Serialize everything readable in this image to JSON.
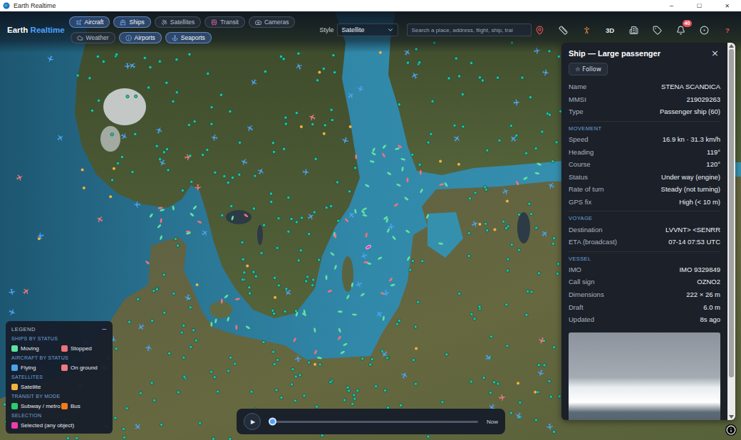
{
  "window": {
    "title": "Earth Realtime",
    "controls": [
      "─",
      "☐",
      "✕"
    ]
  },
  "logo": {
    "primary": "Earth",
    "accent": "Realtime"
  },
  "layer_rows": [
    [
      {
        "label": "Aircraft",
        "selected": true
      },
      {
        "label": "Ships",
        "selected": true
      },
      {
        "label": "Satellites",
        "selected": false
      },
      {
        "label": "Transit",
        "selected": false
      },
      {
        "label": "Cameras",
        "selected": false
      }
    ],
    [
      {
        "label": "Weather",
        "selected": false
      },
      {
        "label": "Airports",
        "selected": true
      },
      {
        "label": "Seaports",
        "selected": true
      }
    ]
  ],
  "style": {
    "label": "Style",
    "value": "Satellite"
  },
  "search": {
    "placeholder": "Search a place, address, flight, ship, trai"
  },
  "tools": [
    {
      "kind": "icon"
    },
    {
      "kind": "icon"
    },
    {
      "kind": "icon"
    },
    {
      "kind": "text",
      "label": "3D"
    },
    {
      "kind": "icon"
    },
    {
      "kind": "icon"
    },
    {
      "kind": "badge",
      "badge": "40"
    },
    {
      "kind": "icon"
    },
    {
      "kind": "help",
      "label": "?"
    }
  ],
  "panel": {
    "title": "Ship — Large passenger",
    "close": "×",
    "follow": "☆ Follow",
    "rows": [
      {
        "label": "Name",
        "value": "STENA SCANDICA"
      },
      {
        "label": "MMSI",
        "value": "219029263"
      },
      {
        "label": "Type",
        "value": "Passenger ship (60)"
      }
    ],
    "sections": [
      {
        "title": "MOVEMENT",
        "rows": [
          {
            "label": "Speed",
            "value": "16.9 kn · 31.3 km/h"
          },
          {
            "label": "Heading",
            "value": "119°"
          },
          {
            "label": "Course",
            "value": "120°"
          },
          {
            "label": "Status",
            "value": "Under way (engine)"
          },
          {
            "label": "Rate of turn",
            "value": "Steady (not turning)"
          },
          {
            "label": "GPS fix",
            "value": "High (< 10 m)"
          }
        ]
      },
      {
        "title": "VOYAGE",
        "rows": [
          {
            "label": "Destination",
            "value": "LVVNT> <SENRR"
          },
          {
            "label": "ETA (broadcast)",
            "value": "07-14 07:53 UTC"
          }
        ]
      },
      {
        "title": "VESSEL",
        "rows": [
          {
            "label": "IMO",
            "value": "IMO 9329849"
          },
          {
            "label": "Call sign",
            "value": "OZNO2"
          },
          {
            "label": "Dimensions",
            "value": "222 × 26 m"
          },
          {
            "label": "Draft",
            "value": "6.0 m"
          },
          {
            "label": "Updated",
            "value": "8s ago"
          }
        ]
      }
    ],
    "scrollbar": {
      "level": 0.9
    }
  },
  "legend": {
    "title": "LEGEND",
    "collapse": "−",
    "sections": [
      {
        "title": "SHIPS BY STATUS",
        "items": [
          {
            "label": "Moving",
            "color": "#5fe3a1"
          },
          {
            "label": "Stopped",
            "color": "#f0727a"
          }
        ]
      },
      {
        "title": "AIRCRAFT BY STATUS",
        "items": [
          {
            "label": "Flying",
            "color": "#4aa3f0"
          },
          {
            "label": "On ground",
            "color": "#f07a80"
          }
        ]
      },
      {
        "title": "SATELLITES",
        "items": [
          {
            "label": "Satellite",
            "color": "#f2b33d"
          }
        ]
      },
      {
        "title": "TRANSIT BY MODE",
        "items": [
          {
            "label": "Subway / metro",
            "color": "#2ecc71"
          },
          {
            "label": "Bus",
            "color": "#f07d1a"
          }
        ]
      },
      {
        "title": "SELECTION",
        "items": [
          {
            "label": "Selected (any object)",
            "color": "#e83fae"
          }
        ]
      }
    ]
  },
  "timeline": {
    "play": "▶",
    "level": 0,
    "label": "Now"
  }
}
